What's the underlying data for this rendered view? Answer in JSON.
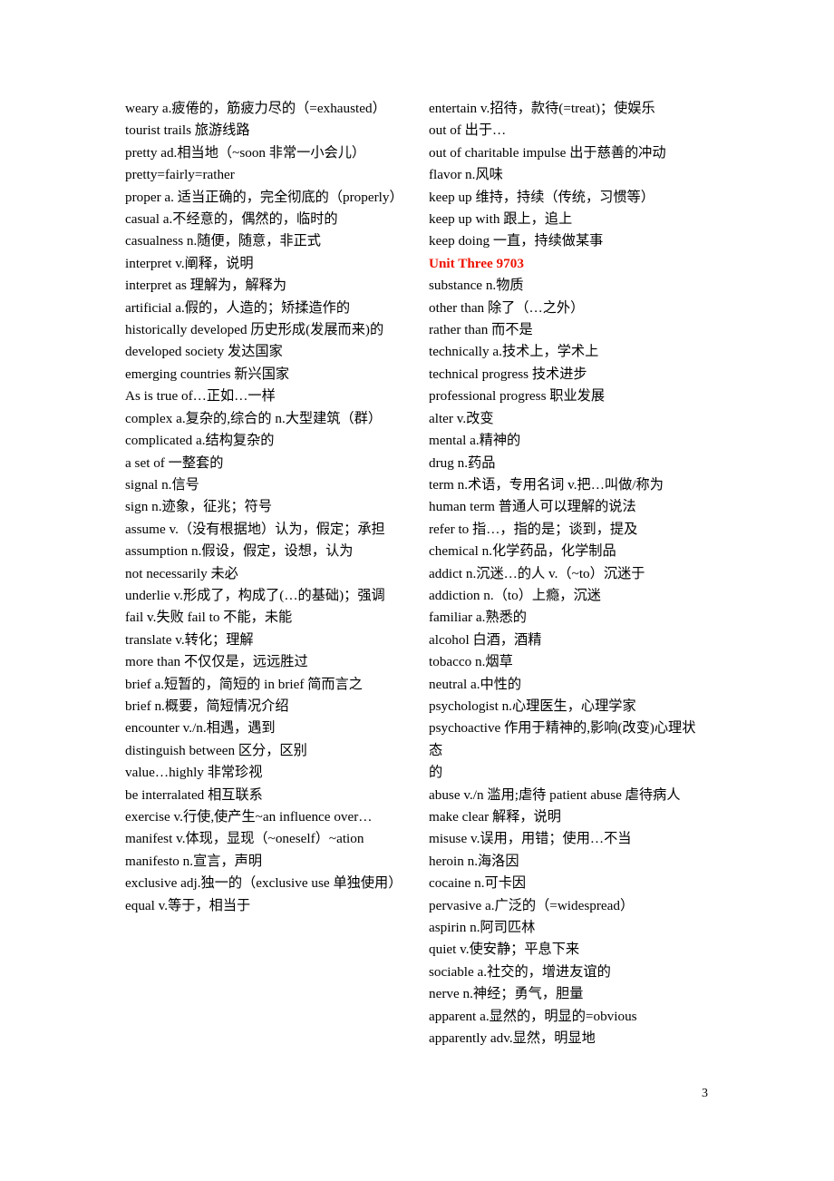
{
  "document": {
    "page_number": "3",
    "accent_color": "#ee1100",
    "left_column": [
      {
        "text": "weary a.疲倦的，筋疲力尽的（=exhausted）",
        "justified": false
      },
      {
        "text": "tourist trails 旅游线路",
        "justified": false
      },
      {
        "text": "pretty ad.相当地（~soon 非常一小会儿）",
        "justified": false
      },
      {
        "text": "pretty=fairly=rather",
        "justified": false
      },
      {
        "text": "proper a. 适当正确的，完全彻底的（properly）",
        "justified": true
      },
      {
        "text": "casual a.不经意的，偶然的，临时的",
        "justified": false
      },
      {
        "text": "casualness n.随便，随意，非正式",
        "justified": false
      },
      {
        "text": "interpret v.阐释，说明",
        "justified": false
      },
      {
        "text": "interpret as 理解为，解释为",
        "justified": false
      },
      {
        "text": "artificial a.假的，人造的；矫揉造作的",
        "justified": false
      },
      {
        "text": "historically developed 历史形成(发展而来)的",
        "justified": false
      },
      {
        "text": "developed society 发达国家",
        "justified": false
      },
      {
        "text": "emerging countries 新兴国家",
        "justified": false
      },
      {
        "text": "As is true of…正如…一样",
        "justified": false
      },
      {
        "text": "complex a.复杂的,综合的 n.大型建筑（群）",
        "justified": false
      },
      {
        "text": "complicated a.结构复杂的",
        "justified": false
      },
      {
        "text": "a set of 一整套的",
        "justified": false
      },
      {
        "text": "signal n.信号",
        "justified": false
      },
      {
        "text": "sign n.迹象，征兆；符号",
        "justified": false
      },
      {
        "text": "assume v.（没有根据地）认为，假定；承担",
        "justified": false
      },
      {
        "text": "assumption n.假设，假定，设想，认为",
        "justified": false
      },
      {
        "text": "not necessarily 未必",
        "justified": false
      },
      {
        "text": "underlie v.形成了，构成了(…的基础)；强调",
        "justified": false
      },
      {
        "text": "fail v.失败 fail to 不能，未能",
        "justified": false
      },
      {
        "text": "translate v.转化；理解",
        "justified": false
      },
      {
        "text": "more than 不仅仅是，远远胜过",
        "justified": false
      },
      {
        "text": "brief a.短暂的，简短的 in brief 简而言之",
        "justified": false
      },
      {
        "text": "brief n.概要，简短情况介绍",
        "justified": false
      },
      {
        "text": "encounter v./n.相遇，遇到",
        "justified": false
      },
      {
        "text": "distinguish between 区分，区别",
        "justified": false
      },
      {
        "text": "value…highly 非常珍视",
        "justified": false
      },
      {
        "text": "be interralated 相互联系",
        "justified": false
      },
      {
        "text": "exercise v.行使,使产生~an influence over…",
        "justified": false
      },
      {
        "text": "manifest v.体现，显现（~oneself）~ation",
        "justified": false
      },
      {
        "text": "manifesto n.宣言，声明",
        "justified": false
      },
      {
        "text": "exclusive adj.独一的（exclusive use 单独使用）",
        "justified": false
      },
      {
        "text": "equal v.等于，相当于",
        "justified": false
      }
    ],
    "right_column": [
      {
        "text": "entertain v.招待，款待(=treat)；使娱乐",
        "justified": false,
        "heading": false
      },
      {
        "text": "out of 出于…",
        "justified": false,
        "heading": false
      },
      {
        "text": "out of charitable impulse 出于慈善的冲动",
        "justified": false,
        "heading": false
      },
      {
        "text": "flavor n.风味",
        "justified": false,
        "heading": false
      },
      {
        "text": "keep up 维持，持续（传统，习惯等）",
        "justified": false,
        "heading": false
      },
      {
        "text": "keep up with 跟上，追上",
        "justified": false,
        "heading": false
      },
      {
        "text": "keep doing 一直，持续做某事",
        "justified": false,
        "heading": false
      },
      {
        "text": "Unit Three 9703",
        "justified": false,
        "heading": true
      },
      {
        "text": "substance n.物质",
        "justified": false,
        "heading": false
      },
      {
        "text": "other than 除了（…之外）",
        "justified": false,
        "heading": false
      },
      {
        "text": "rather than 而不是",
        "justified": false,
        "heading": false
      },
      {
        "text": "technically a.技术上，学术上",
        "justified": false,
        "heading": false
      },
      {
        "text": "technical progress 技术进步",
        "justified": false,
        "heading": false
      },
      {
        "text": "professional progress 职业发展",
        "justified": false,
        "heading": false
      },
      {
        "text": "alter v.改变",
        "justified": false,
        "heading": false
      },
      {
        "text": "mental a.精神的",
        "justified": false,
        "heading": false
      },
      {
        "text": "drug n.药品",
        "justified": false,
        "heading": false
      },
      {
        "text": "term n.术语，专用名词 v.把…叫做/称为",
        "justified": false,
        "heading": false
      },
      {
        "text": "human term 普通人可以理解的说法",
        "justified": false,
        "heading": false
      },
      {
        "text": "refer to 指…，指的是；谈到，提及",
        "justified": false,
        "heading": false
      },
      {
        "text": "chemical n.化学药品，化学制品",
        "justified": false,
        "heading": false
      },
      {
        "text": "addict n.沉迷…的人 v.（~to）沉迷于",
        "justified": false,
        "heading": false
      },
      {
        "text": "addiction n.（to）上瘾，沉迷",
        "justified": false,
        "heading": false
      },
      {
        "text": "familiar a.熟悉的",
        "justified": false,
        "heading": false
      },
      {
        "text": "alcohol 白酒，酒精",
        "justified": false,
        "heading": false
      },
      {
        "text": "tobacco n.烟草",
        "justified": false,
        "heading": false
      },
      {
        "text": "neutral a.中性的",
        "justified": false,
        "heading": false
      },
      {
        "text": "psychologist n.心理医生，心理学家",
        "justified": false,
        "heading": false
      },
      {
        "text": "psychoactive 作用于精神的,影响(改变)心理状态",
        "justified": false,
        "heading": false
      },
      {
        "text": "的",
        "justified": false,
        "heading": false
      },
      {
        "text": "abuse v./n 滥用;虐待 patient abuse 虐待病人",
        "justified": false,
        "heading": false
      },
      {
        "text": "make clear 解释，说明",
        "justified": false,
        "heading": false
      },
      {
        "text": "misuse v.误用，用错；使用…不当",
        "justified": false,
        "heading": false
      },
      {
        "text": "heroin n.海洛因",
        "justified": false,
        "heading": false
      },
      {
        "text": "cocaine n.可卡因",
        "justified": false,
        "heading": false
      },
      {
        "text": "pervasive a.广泛的（=widespread）",
        "justified": false,
        "heading": false
      },
      {
        "text": "aspirin n.阿司匹林",
        "justified": false,
        "heading": false
      },
      {
        "text": "quiet v.使安静；平息下来",
        "justified": false,
        "heading": false
      },
      {
        "text": "sociable a.社交的，增进友谊的",
        "justified": false,
        "heading": false
      },
      {
        "text": "nerve n.神经；勇气，胆量",
        "justified": false,
        "heading": false
      },
      {
        "text": "apparent a.显然的，明显的=obvious",
        "justified": false,
        "heading": false
      },
      {
        "text": "apparently adv.显然，明显地",
        "justified": false,
        "heading": false
      }
    ]
  }
}
